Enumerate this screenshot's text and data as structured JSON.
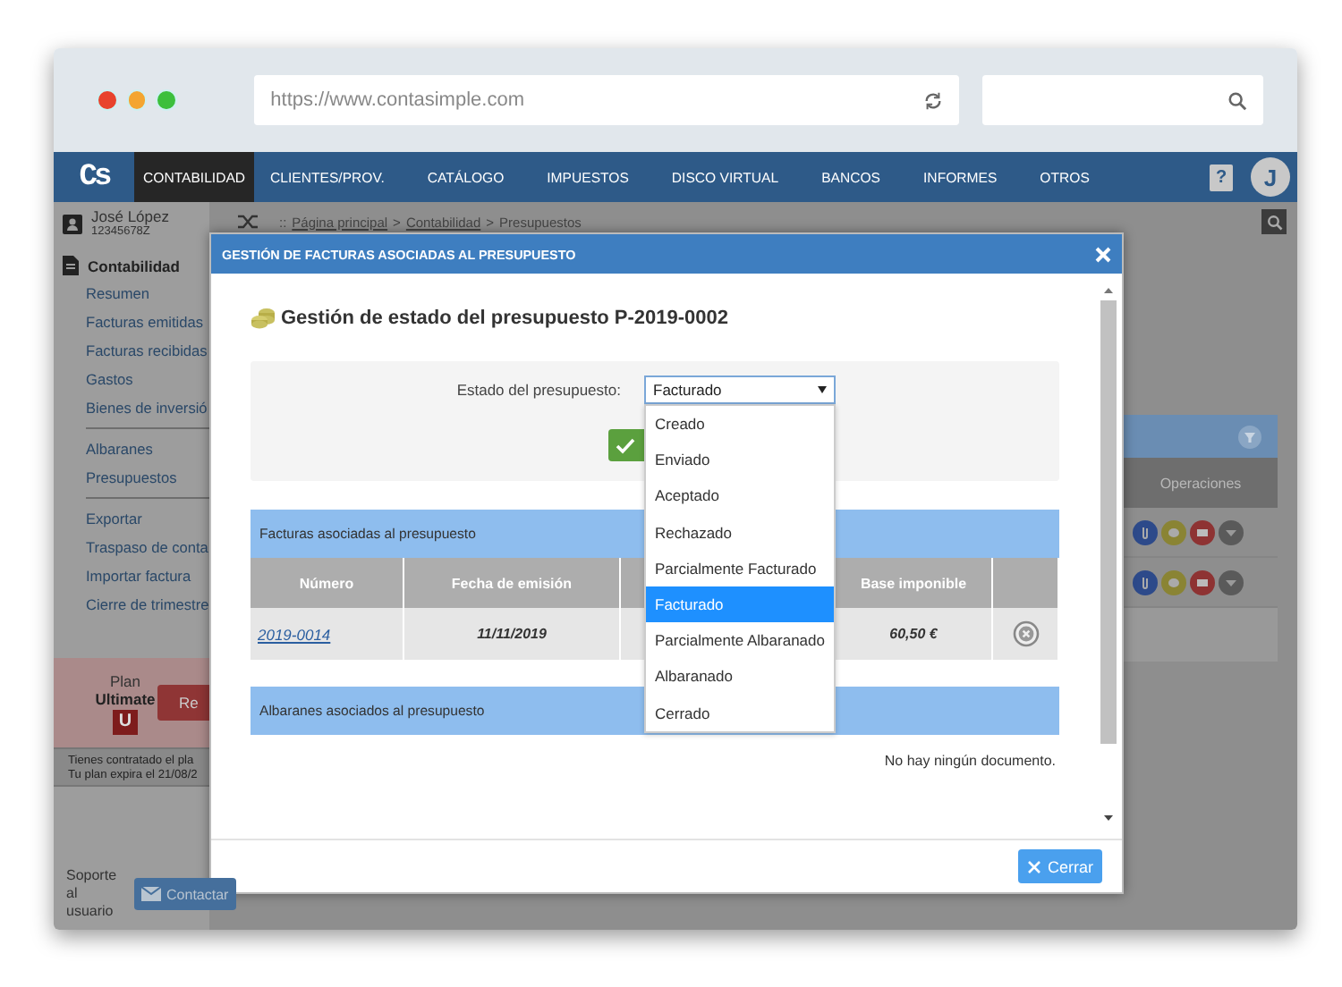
{
  "browser": {
    "url": "https://www.contasimple.com"
  },
  "navbar": {
    "logo": "Cs",
    "tabs": [
      {
        "label": "CONTABILIDAD",
        "selected": true
      },
      {
        "label": "CLIENTES/PROV.",
        "selected": false
      },
      {
        "label": "CATÁLOGO",
        "selected": false
      },
      {
        "label": "IMPUESTOS",
        "selected": false
      },
      {
        "label": "DISCO VIRTUAL",
        "selected": false
      },
      {
        "label": "BANCOS",
        "selected": false
      },
      {
        "label": "INFORMES",
        "selected": false
      },
      {
        "label": "OTROS",
        "selected": false
      }
    ],
    "help": "?",
    "avatar": "J"
  },
  "user": {
    "name": "José López",
    "id": "12345678Z"
  },
  "sidebar": {
    "section": "Contabilidad",
    "groups": [
      [
        "Resumen",
        "Facturas emitidas",
        "Facturas recibidas",
        "Gastos",
        "Bienes de inversió"
      ],
      [
        "Albaranes",
        "Presupuestos"
      ],
      [
        "Exportar",
        "Traspaso de conta",
        "Importar factura",
        "Cierre de trimestre"
      ]
    ]
  },
  "plan": {
    "label": "Plan",
    "name": "Ultimate",
    "badge": "U",
    "button": "Re",
    "notice": [
      "Tienes contratado el pla",
      "Tu plan expira el 21/08/2"
    ]
  },
  "support": {
    "label": "Soporte al usuario",
    "button": "Contactar"
  },
  "breadcrumb": {
    "prefix": "::",
    "separator": ">",
    "items": [
      {
        "label": "Página principal",
        "link": true
      },
      {
        "label": "Contabilidad",
        "link": true
      },
      {
        "label": "Presupuestos",
        "link": false
      }
    ]
  },
  "background_table": {
    "column": "Operaciones"
  },
  "modal": {
    "title": "GESTIÓN DE FACTURAS ASOCIADAS AL PRESUPUESTO",
    "heading": "Gestión de estado del presupuesto P-2019-0002",
    "status_field": {
      "label": "Estado del presupuesto:",
      "value": "Facturado",
      "expanded": true,
      "options": [
        {
          "label": "Creado",
          "selected": false
        },
        {
          "label": "Enviado",
          "selected": false
        },
        {
          "label": "Aceptado",
          "selected": false
        },
        {
          "label": "Rechazado",
          "selected": false
        },
        {
          "label": "Parcialmente Facturado",
          "selected": false
        },
        {
          "label": "Facturado",
          "selected": true
        },
        {
          "label": "Parcialmente Albaranado",
          "selected": false
        },
        {
          "label": "Albaranado",
          "selected": false
        },
        {
          "label": "Cerrado",
          "selected": false
        }
      ]
    },
    "invoices": {
      "title": "Facturas asociadas al presupuesto",
      "columns": [
        "Número",
        "Fecha de emisión",
        "Base imponible"
      ],
      "rows": [
        {
          "number": "2019-0014",
          "date": "11/11/2019",
          "base": "60,50 €"
        }
      ]
    },
    "delivery_notes": {
      "title": "Albaranes asociados al presupuesto",
      "empty": "No hay ningún documento."
    },
    "close_button": "Cerrar"
  }
}
